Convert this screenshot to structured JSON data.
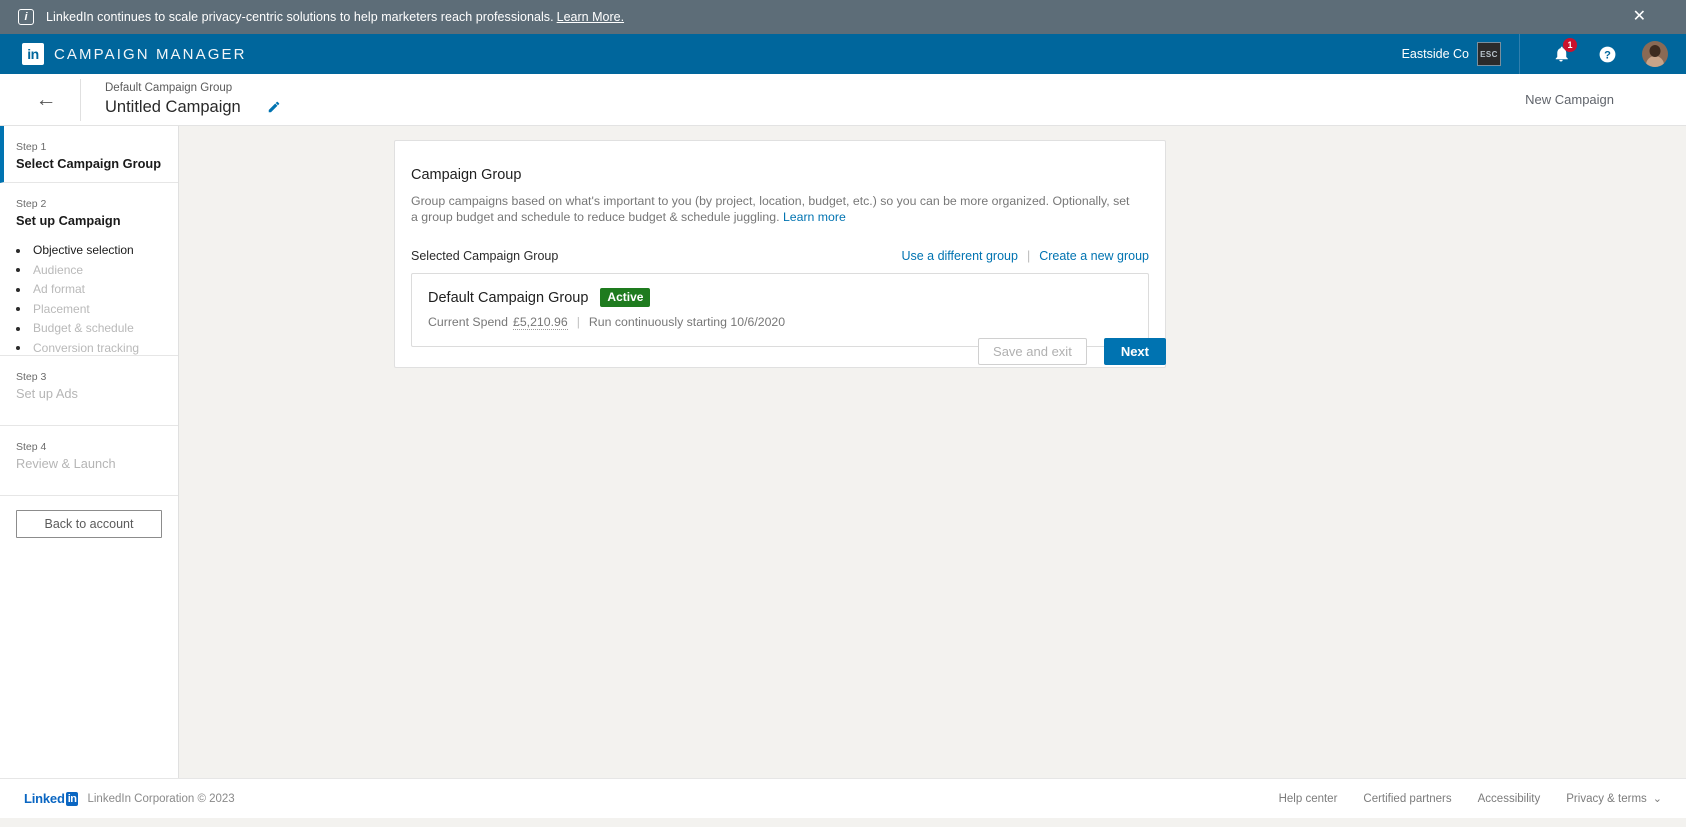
{
  "banner": {
    "icon": "info-icon",
    "text": "LinkedIn continues to scale privacy-centric solutions to help marketers reach professionals.",
    "link_label": "Learn More.",
    "close_label": "✕"
  },
  "globalnav": {
    "logo_text": "in",
    "product_name": "CAMPAIGN MANAGER",
    "account_name": "Eastside Co",
    "account_badge": "ESC",
    "notifications_count": "1",
    "help_label": "?",
    "brand_color": "#00669c"
  },
  "titlebar": {
    "back_label": "←",
    "group_name": "Default Campaign Group",
    "campaign_name": "Untitled Campaign",
    "edit_icon": "pencil-icon",
    "new_campaign_label": "New Campaign"
  },
  "sidebar": {
    "steps": [
      {
        "label": "Step 1",
        "name": "Select Campaign Group",
        "state": "active",
        "substeps": []
      },
      {
        "label": "Step 2",
        "name": "Set up Campaign",
        "state": "upcoming",
        "substeps": [
          {
            "label": "Objective selection",
            "state": "current"
          },
          {
            "label": "Audience",
            "state": "disabled"
          },
          {
            "label": "Ad format",
            "state": "disabled"
          },
          {
            "label": "Placement",
            "state": "disabled"
          },
          {
            "label": "Budget & schedule",
            "state": "disabled"
          },
          {
            "label": "Conversion tracking",
            "state": "disabled"
          }
        ]
      },
      {
        "label": "Step 3",
        "name": "Set up Ads",
        "state": "disabled",
        "substeps": []
      },
      {
        "label": "Step 4",
        "name": "Review & Launch",
        "state": "disabled",
        "substeps": []
      }
    ],
    "back_to_account_label": "Back to account"
  },
  "main": {
    "card_title": "Campaign Group",
    "card_description": "Group campaigns based on what's important to you (by project, location, budget, etc.) so you can be more organized. Optionally, set a group budget and schedule to reduce budget & schedule juggling.",
    "card_description_link": "Learn more",
    "selected_label": "Selected Campaign Group",
    "use_different_group_label": "Use a different group",
    "link_separator": "|",
    "create_new_group_label": "Create a new group",
    "group": {
      "name": "Default Campaign Group",
      "status": "Active",
      "status_color": "#1e7b1e",
      "spend_label": "Current Spend",
      "spend_value": "£5,210.96",
      "meta_separator": "|",
      "schedule": "Run continuously starting 10/6/2020"
    },
    "save_and_exit_label": "Save and exit",
    "next_label": "Next"
  },
  "footer": {
    "logo_word": "Linked",
    "logo_box": "in",
    "copyright": "LinkedIn Corporation © 2023",
    "links": [
      {
        "label": "Help center"
      },
      {
        "label": "Certified partners"
      },
      {
        "label": "Accessibility"
      },
      {
        "label": "Privacy & terms"
      }
    ],
    "chevron": "⌄"
  }
}
